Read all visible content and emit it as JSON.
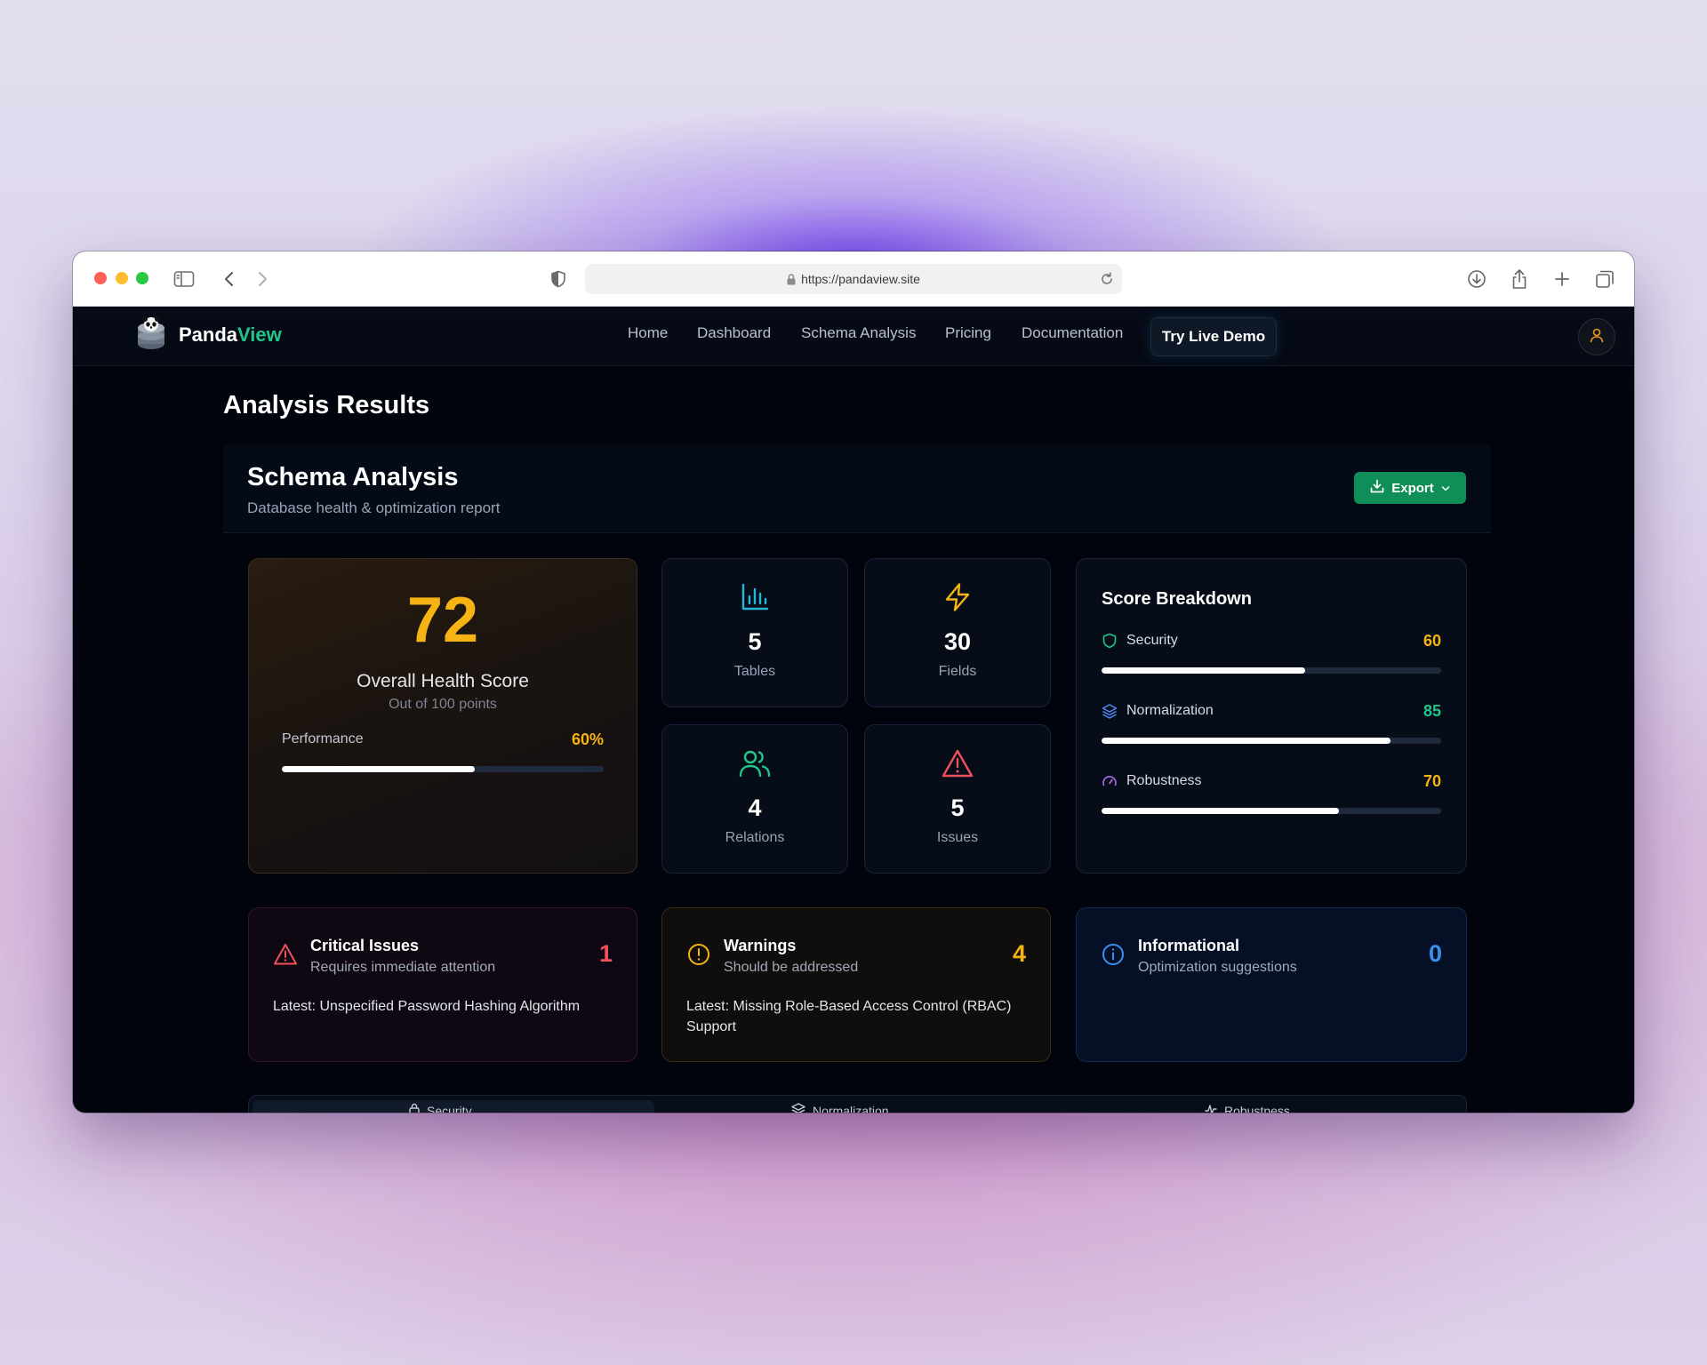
{
  "browser": {
    "url": "https://pandaview.site"
  },
  "nav": {
    "brand_part1": "Panda",
    "brand_part2": "View",
    "links": [
      "Home",
      "Dashboard",
      "Schema Analysis",
      "Pricing",
      "Documentation"
    ],
    "cta": "Try Live Demo"
  },
  "page": {
    "title": "Analysis Results"
  },
  "schema": {
    "title": "Schema Analysis",
    "subtitle": "Database health & optimization report",
    "export_label": "Export"
  },
  "health": {
    "score": "72",
    "label": "Overall Health Score",
    "sub": "Out of 100 points",
    "performance_label": "Performance",
    "performance_value": "60%",
    "performance_fraction": 0.6
  },
  "stats": [
    {
      "value": "5",
      "label": "Tables",
      "icon": "bar-chart-icon"
    },
    {
      "value": "30",
      "label": "Fields",
      "icon": "lightning-icon"
    },
    {
      "value": "4",
      "label": "Relations",
      "icon": "users-icon"
    },
    {
      "value": "5",
      "label": "Issues",
      "icon": "warning-triangle-icon"
    }
  ],
  "breakdown": {
    "title": "Score Breakdown",
    "rows": [
      {
        "label": "Security",
        "value": "60",
        "fraction": 0.6,
        "color": "#f6b314",
        "icon": "shield-icon"
      },
      {
        "label": "Normalization",
        "value": "85",
        "fraction": 0.85,
        "color": "#20c58a",
        "icon": "layers-icon"
      },
      {
        "label": "Robustness",
        "value": "70",
        "fraction": 0.7,
        "color": "#f6b314",
        "icon": "gauge-icon"
      }
    ]
  },
  "issues": {
    "critical": {
      "title": "Critical Issues",
      "sub": "Requires immediate attention",
      "count": "1",
      "latest": "Latest: Unspecified Password Hashing Algorithm",
      "color": "#f0505a"
    },
    "warnings": {
      "title": "Warnings",
      "sub": "Should be addressed",
      "count": "4",
      "latest": "Latest: Missing Role-Based Access Control (RBAC) Support",
      "color": "#f6b314"
    },
    "informational": {
      "title": "Informational",
      "sub": "Optimization suggestions",
      "count": "0",
      "color": "#3b8ff0"
    }
  },
  "tabs": [
    "Security",
    "Normalization",
    "Robustness"
  ]
}
